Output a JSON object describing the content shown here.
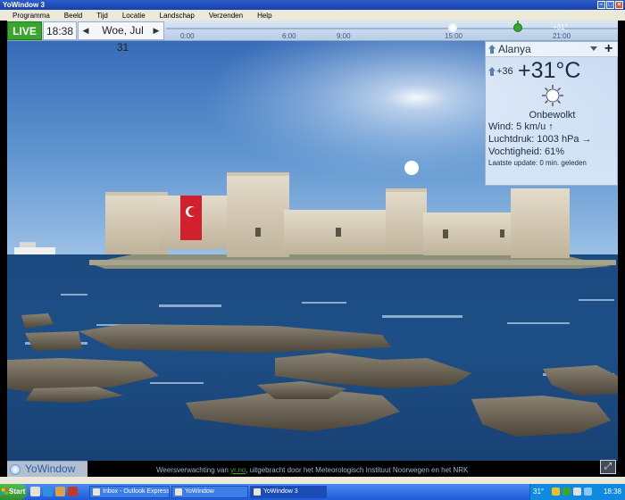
{
  "window": {
    "title": "YoWindow 3"
  },
  "menu": [
    "Programma",
    "Beeld",
    "Tijd",
    "Locatie",
    "Landschap",
    "Verzenden",
    "Help"
  ],
  "timebar": {
    "live_label": "LIVE",
    "clock": "18:38",
    "date": "Woe, Jul 31",
    "ticks": [
      "0:00",
      "6:00",
      "9:00",
      "15:00",
      "21:00"
    ],
    "now_temp": "+31°"
  },
  "weather": {
    "location": "Alanya",
    "feels_like": "+36",
    "temperature": "+31°C",
    "condition": "Onbewolkt",
    "wind": "Wind:  5 km/u  ↑",
    "pressure": "Luchtdruk:  1003 hPa →",
    "humidity": "Vochtigheid:  61%",
    "last_update": "Laatste update:  0 min. geleden"
  },
  "footer": {
    "logo": "YoWindow",
    "credit_prefix": "Weersverwachting van ",
    "credit_link": "yr.no",
    "credit_suffix": ", uitgebracht door het Meteorologisch Instituut Noorwegen en het NRK"
  },
  "taskbar": {
    "start_label": "Start",
    "tasks": [
      "Inbox - Outlook Express",
      "YoWindow",
      "YoWindow 3"
    ],
    "tray_temp": "31°",
    "tray_time": "18:38"
  },
  "colors": {
    "live_green": "#3aa52c",
    "sea": "#1d4f86",
    "sky": "#4b80c0"
  }
}
